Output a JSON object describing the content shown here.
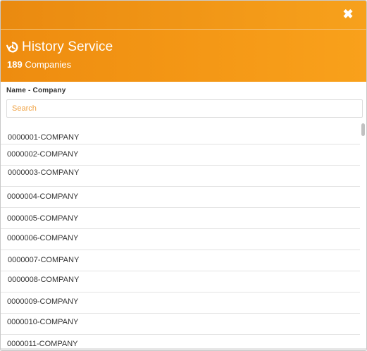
{
  "dialog": {
    "close_icon": "close-icon",
    "title_icon": "history-icon",
    "title": "History Service",
    "count": "189",
    "count_label": "Companies"
  },
  "filter": {
    "label": "Name - Company",
    "placeholder": "Search",
    "value": ""
  },
  "companies": [
    "0000001-COMPANY",
    "0000002-COMPANY",
    "0000003-COMPANY",
    "0000004-COMPANY",
    "0000005-COMPANY",
    "0000006-COMPANY",
    "0000007-COMPANY",
    "0000008-COMPANY",
    "0000009-COMPANY",
    "0000010-COMPANY",
    "0000011-COMPANY"
  ],
  "colors": {
    "accent": "#f59b18",
    "placeholder": "#f0a345"
  }
}
